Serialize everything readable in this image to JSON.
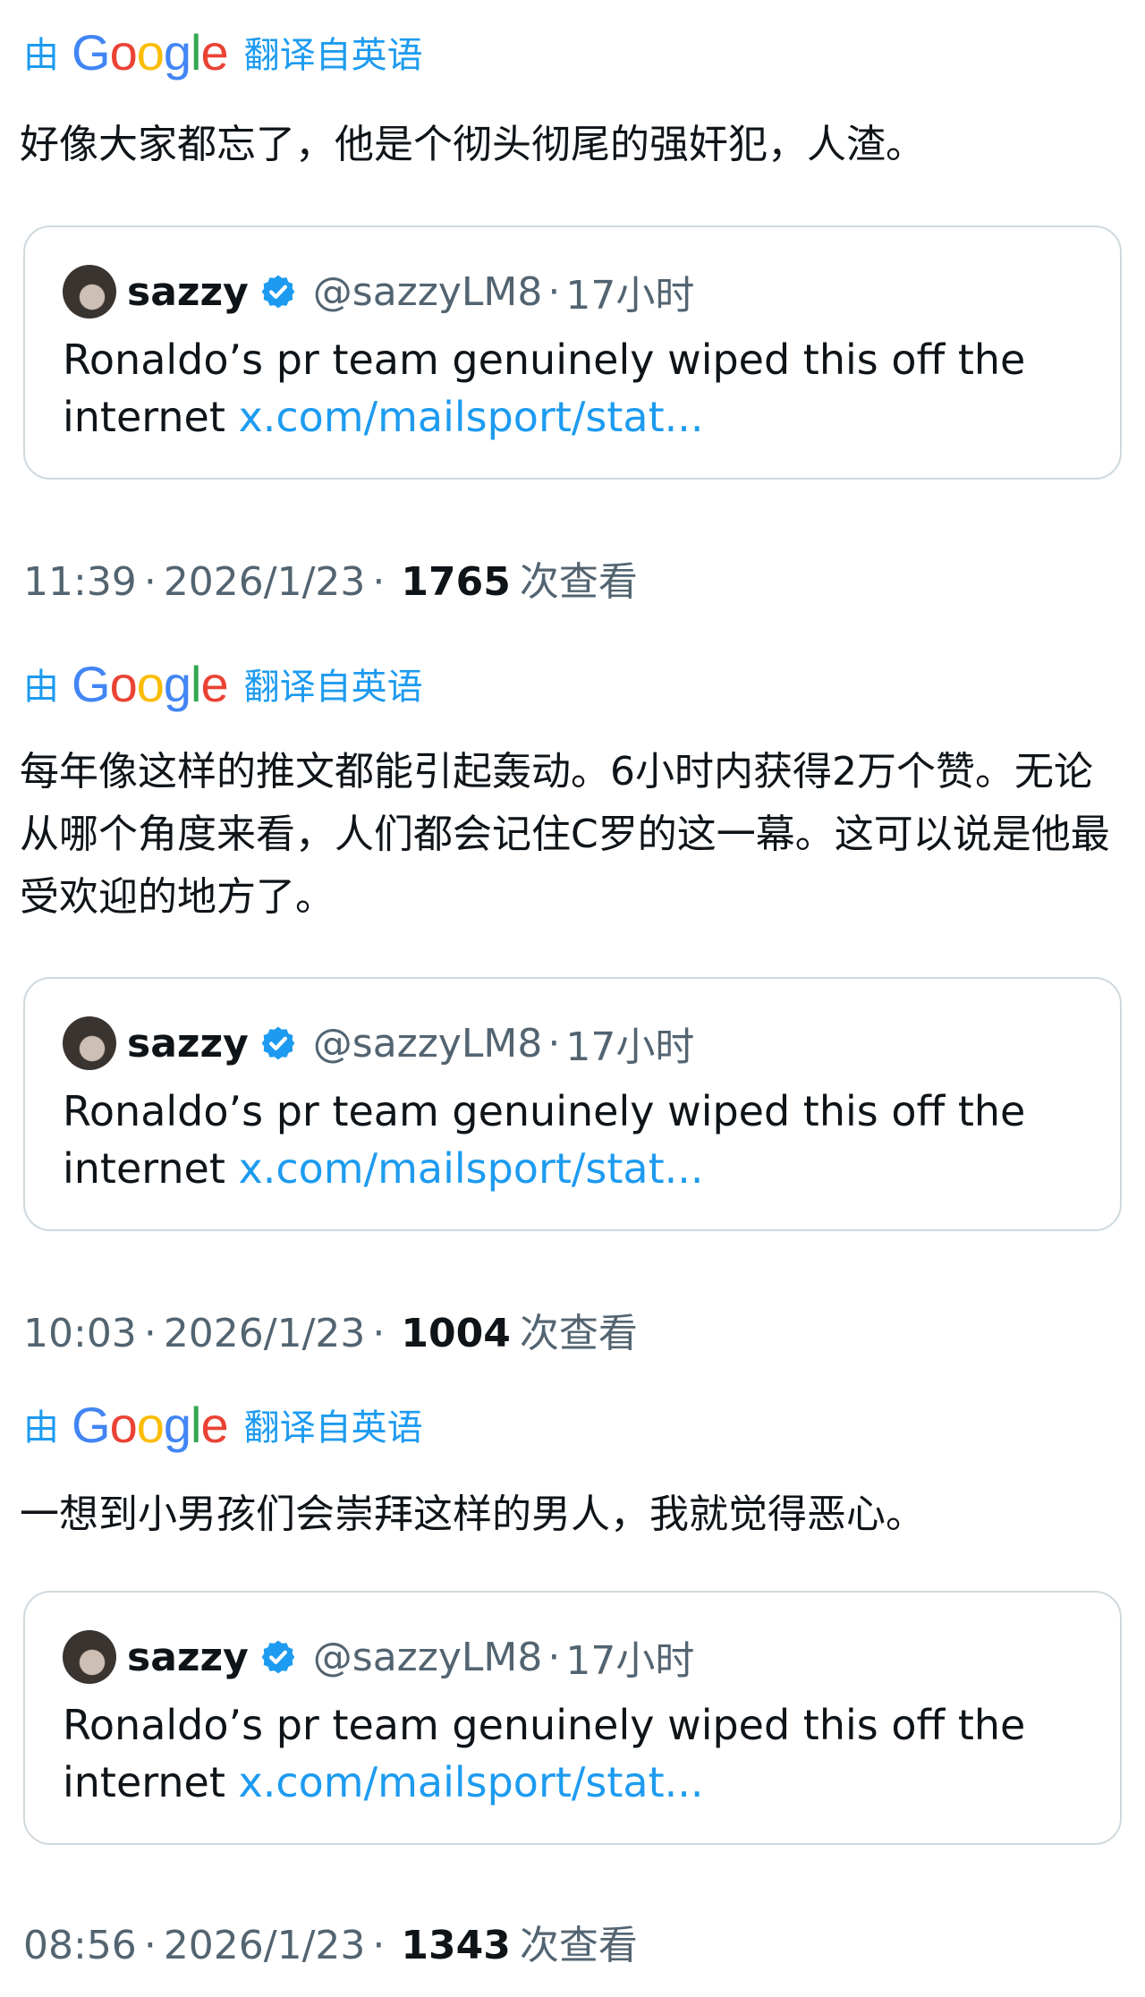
{
  "translate": {
    "prefix": "由",
    "google": [
      "G",
      "o",
      "o",
      "g",
      "l",
      "e"
    ],
    "google_colors": [
      "#4285F4",
      "#EA4335",
      "#FBBC05",
      "#4285F4",
      "#34A853",
      "#EA4335"
    ],
    "suffix": "翻译自英语"
  },
  "accent_color": "#1d9bf0",
  "posts": [
    {
      "text": "好像大家都忘了，他是个彻头彻尾的强奸犯，人渣。",
      "quote": {
        "name": "sazzy",
        "handle": "@sazzyLM8",
        "sep": "·",
        "time": "17小时",
        "body": "Ronaldo’s pr team genuinely wiped this off the internet ",
        "link": "x.com/mailsport/stat..."
      },
      "time": "11:39",
      "date": "2026/1/23",
      "views": "1765",
      "views_label": "次查看"
    },
    {
      "text": "每年像这样的推文都能引起轰动。6小时内获得2万个赞。无论从哪个角度来看，人们都会记住C罗的这一幕。这可以说是他最受欢迎的地方了。",
      "quote": {
        "name": "sazzy",
        "handle": "@sazzyLM8",
        "sep": "·",
        "time": "17小时",
        "body": "Ronaldo’s pr team genuinely wiped this off the internet ",
        "link": "x.com/mailsport/stat..."
      },
      "time": "10:03",
      "date": "2026/1/23",
      "views": "1004",
      "views_label": "次查看"
    },
    {
      "text": "一想到小男孩们会崇拜这样的男人，我就觉得恶心。",
      "quote": {
        "name": "sazzy",
        "handle": "@sazzyLM8",
        "sep": "·",
        "time": "17小时",
        "body": "Ronaldo’s pr team genuinely wiped this off the internet ",
        "link": "x.com/mailsport/stat..."
      },
      "time": "08:56",
      "date": "2026/1/23",
      "views": "1343",
      "views_label": "次查看"
    }
  ]
}
